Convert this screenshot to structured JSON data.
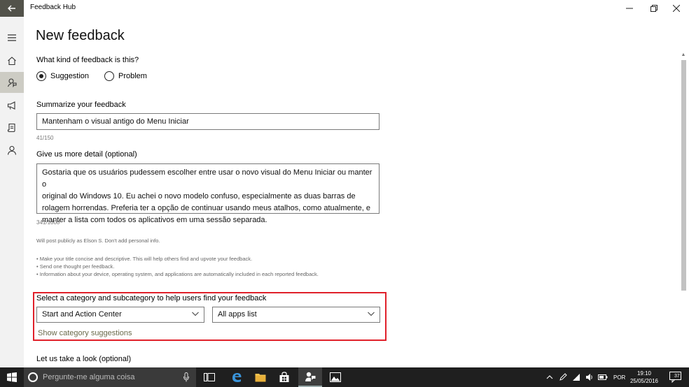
{
  "window": {
    "title": "Feedback Hub",
    "back_icon": "back-arrow-icon"
  },
  "rail": {
    "items": [
      {
        "name": "menu",
        "icon": "hamburger-icon"
      },
      {
        "name": "home",
        "icon": "home-icon"
      },
      {
        "name": "feedback",
        "icon": "feedback-icon",
        "selected": true
      },
      {
        "name": "announcements",
        "icon": "megaphone-icon"
      },
      {
        "name": "quests",
        "icon": "quest-icon"
      },
      {
        "name": "profile",
        "icon": "person-icon"
      }
    ]
  },
  "form": {
    "page_title": "New feedback",
    "question": "What kind of feedback is this?",
    "type_options": [
      {
        "label": "Suggestion",
        "selected": true
      },
      {
        "label": "Problem",
        "selected": false
      }
    ],
    "summary_label": "Summarize your feedback",
    "summary_value": "Mantenham o visual antigo do Menu Iniciar",
    "summary_count": "41/150",
    "detail_label": "Give us more detail (optional)",
    "detail_lines": [
      "Gostaria que os usuários pudessem escolher entre usar o novo visual do Menu Iniciar ou manter o",
      "original do Windows 10. Eu achei o novo modelo confuso, especialmente as duas barras de",
      "rolagem horrendas.  Preferia ter a opção de continuar usando meus atalhos, como atualmente, e",
      "manter a lista com todos os aplicativos em uma sessão separada."
    ],
    "detail_count": "341/1000",
    "public_note": "Will post publicly as Elson S. Don't add personal info.",
    "tips": [
      "• Make your title concise and descriptive. This will help others find and upvote your feedback.",
      "• Send one thought per feedback.",
      "• Information about your device, operating system, and applications are automatically included in each reported feedback."
    ],
    "category_label": "Select a category and subcategory to help users find your feedback",
    "category_value": "Start and Action Center",
    "subcategory_value": "All apps list",
    "suggestions_link": "Show category suggestions",
    "look_label": "Let us take a look (optional)"
  },
  "taskbar": {
    "search_placeholder": "Pergunte-me alguma coisa",
    "apps": [
      "task-view-icon",
      "edge-icon",
      "file-explorer-icon",
      "store-icon",
      "feedback-hub-icon",
      "photos-icon"
    ],
    "language": "POR",
    "time": "19:10",
    "date": "25/05/2016",
    "notification_count": "37"
  },
  "colors": {
    "highlight_border": "#e0202a",
    "rail_selected": "#cdccc4",
    "taskbar": "#1f1f1f",
    "link": "#6a6a4a"
  }
}
